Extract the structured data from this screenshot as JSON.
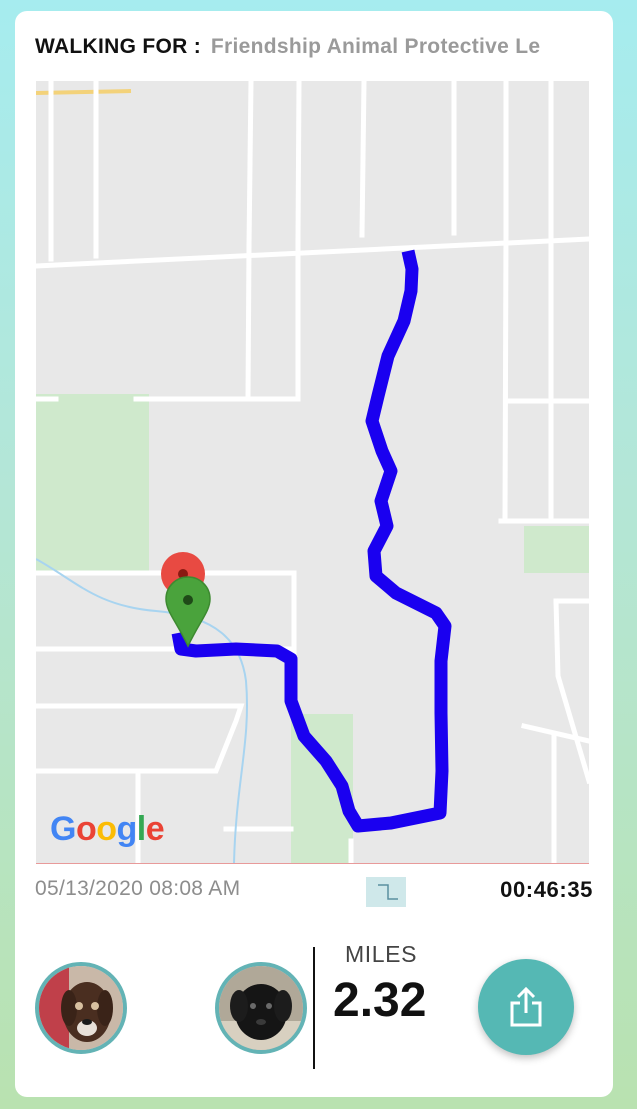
{
  "header": {
    "label": "WALKING FOR :",
    "organization": "Friendship Animal Protective Le"
  },
  "map": {
    "provider_logo": [
      "G",
      "o",
      "o",
      "g",
      "l",
      "e"
    ],
    "route_color": "#1a00f0",
    "start_marker_color": "#4aa33c",
    "end_marker_color": "#e84a42"
  },
  "walk": {
    "date_time": "05/13/2020 08:08 AM",
    "duration": "00:46:35",
    "distance_label": "MILES",
    "distance_value": "2.32"
  },
  "dogs": [
    {
      "icon": "brown-dog-avatar"
    },
    {
      "icon": "black-dog-avatar"
    }
  ],
  "actions": {
    "share_icon": "share-icon",
    "accent_color": "#55b8b4"
  }
}
